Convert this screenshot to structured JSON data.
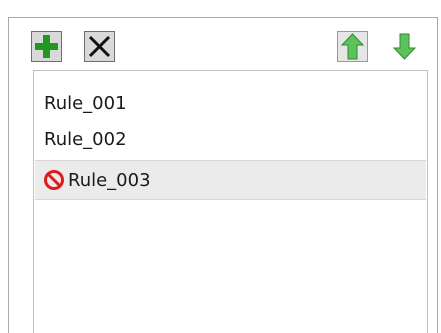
{
  "toolbar": {
    "add": {
      "icon": "plus-icon",
      "color": "#1f9a1f"
    },
    "delete": {
      "icon": "x-icon",
      "color": "#111111"
    },
    "move_up": {
      "icon": "arrow-up-icon",
      "color": "#4db84d"
    },
    "move_down": {
      "icon": "arrow-down-icon",
      "color": "#4db84d"
    }
  },
  "rules": [
    {
      "label": "Rule_001",
      "disabled": false,
      "selected": false
    },
    {
      "label": "Rule_002",
      "disabled": false,
      "selected": false
    },
    {
      "label": "Rule_003",
      "disabled": true,
      "selected": true,
      "status_icon": "disabled-icon",
      "status_color": "#e01b1b"
    }
  ]
}
